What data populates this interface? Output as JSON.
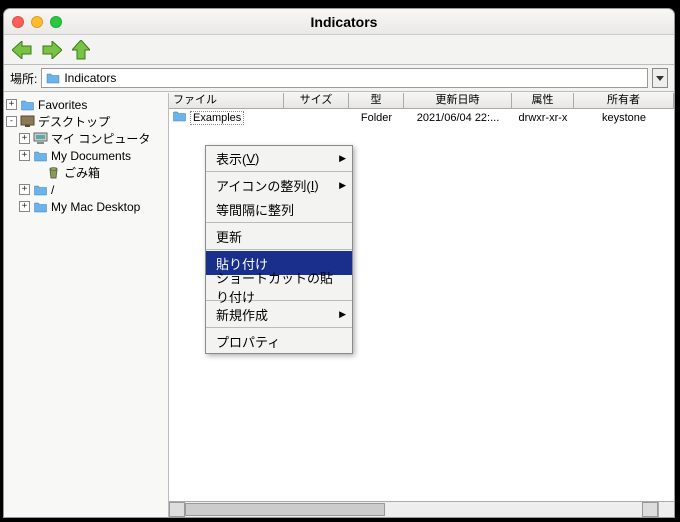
{
  "window": {
    "title": "Indicators"
  },
  "location": {
    "label": "場所:",
    "value": "Indicators"
  },
  "tree": {
    "items": [
      {
        "indent": 0,
        "exp": "+",
        "icon": "folder",
        "label": "Favorites"
      },
      {
        "indent": 0,
        "exp": "-",
        "icon": "desktop",
        "label": "デスクトップ"
      },
      {
        "indent": 1,
        "exp": "+",
        "icon": "computer",
        "label": "マイ コンピュータ"
      },
      {
        "indent": 1,
        "exp": "+",
        "icon": "folder",
        "label": "My Documents"
      },
      {
        "indent": 2,
        "exp": "",
        "icon": "trash",
        "label": "ごみ箱"
      },
      {
        "indent": 1,
        "exp": "+",
        "icon": "folder",
        "label": "/"
      },
      {
        "indent": 1,
        "exp": "+",
        "icon": "folder",
        "label": "My Mac Desktop"
      }
    ]
  },
  "columns": {
    "c1": "ファイル",
    "c2": "サイズ",
    "c3": "型",
    "c4": "更新日時",
    "c5": "属性",
    "c6": "所有者"
  },
  "rows": [
    {
      "name": "Examples",
      "size": "",
      "type": "Folder",
      "modified": "2021/06/04 22:...",
      "attrs": "drwxr-xr-x",
      "owner": "keystone"
    }
  ],
  "context_menu": {
    "items": [
      {
        "label": "表示(V)",
        "submenu": true,
        "accel": "V"
      },
      {
        "sep": true
      },
      {
        "label": "アイコンの整列(I)",
        "submenu": true,
        "accel": "I"
      },
      {
        "label": "等間隔に整列"
      },
      {
        "sep": true
      },
      {
        "label": "更新"
      },
      {
        "sep": true
      },
      {
        "label": "貼り付け",
        "selected": true
      },
      {
        "label": "ショートカットの貼り付け"
      },
      {
        "sep": true
      },
      {
        "label": "新規作成",
        "submenu": true
      },
      {
        "sep": true
      },
      {
        "label": "プロパティ"
      }
    ]
  }
}
